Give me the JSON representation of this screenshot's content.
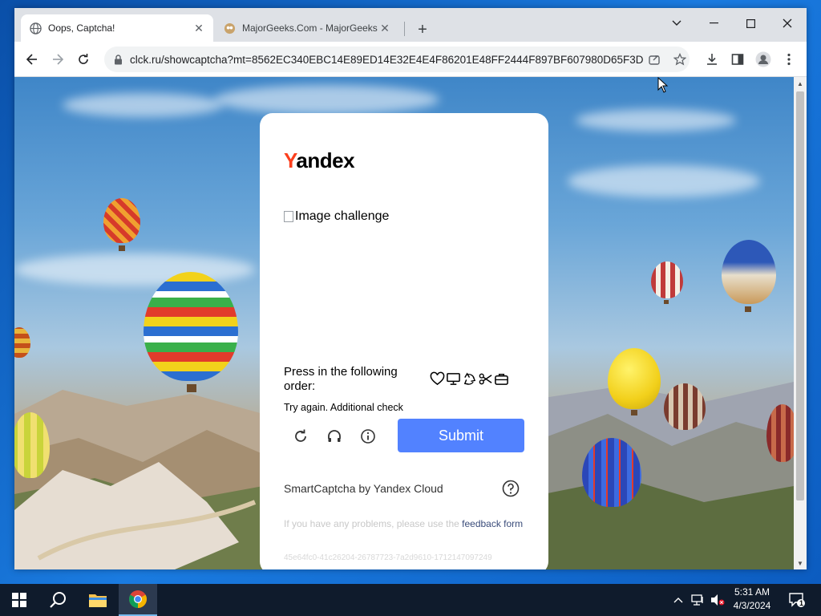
{
  "browser": {
    "tabs": [
      {
        "label": "Oops, Captcha!",
        "active": true,
        "favicon": "globe-icon"
      },
      {
        "label": "MajorGeeks.Com - MajorGeeks",
        "active": false,
        "favicon": "majorgeeks-icon"
      }
    ],
    "address_bar": {
      "url": "clck.ru/showcaptcha?mt=8562EC340EBC14E89ED14E32E4E4F86201E48FF2444F897BF607980D65F3D..."
    }
  },
  "captcha": {
    "logo_first_letter": "Y",
    "logo_rest": "andex",
    "image_alt": "Image challenge",
    "instruction": "Press in the following order:",
    "icon_sequence": [
      "heart-icon",
      "monitor-icon",
      "recycle-icon",
      "scissors-icon",
      "briefcase-icon"
    ],
    "error_text": "Try again. Additional check",
    "submit_label": "Submit",
    "brand_text": "SmartCaptcha by Yandex Cloud",
    "feedback_text": "If you have any problems, please use the ",
    "feedback_link": "feedback form",
    "token": "45e64fc0-41c26204-26787723-7a2d9610-1712147097249",
    "accent_color": "#5282ff",
    "logo_color": "#fc3f1d"
  },
  "taskbar": {
    "time": "5:31 AM",
    "date": "4/3/2024",
    "notification_count": "1"
  }
}
